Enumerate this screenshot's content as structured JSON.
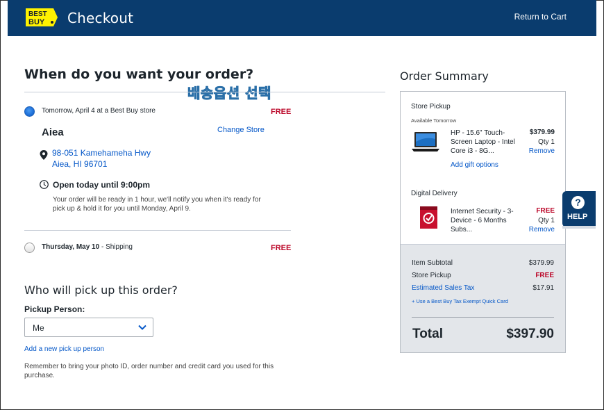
{
  "header": {
    "logo_alt": "Best Buy logo",
    "logo_text_line1": "BEST",
    "logo_text_line2": "BUY",
    "title": "Checkout",
    "return_to_cart": "Return to Cart"
  },
  "overlay_annotation": "배송옵션 선택",
  "delivery": {
    "heading": "When do you want your order?",
    "options": [
      {
        "label": "Tomorrow, April 4 at a Best Buy store",
        "price": "FREE",
        "selected": true
      },
      {
        "label_bold": "Thursday, May 10",
        "label_rest": " - Shipping",
        "price": "FREE",
        "selected": false
      }
    ],
    "store": {
      "name": "Aiea",
      "change_store": "Change Store",
      "address_line1": "98-051 Kamehameha Hwy",
      "address_line2": "Aiea, HI 96701",
      "hours": "Open today until 9:00pm",
      "ready_note": "Your order will be ready in 1 hour, we'll notify you when it's ready for pick up & hold it for you until Monday, April 9."
    }
  },
  "pickup": {
    "heading": "Who will pick up this order?",
    "person_label": "Pickup Person:",
    "person_value": "Me",
    "add_person": "Add a new pick up person",
    "remember_note": "Remember to bring your photo ID, order number and credit card you used for this purchase."
  },
  "summary": {
    "heading": "Order Summary",
    "store_pickup_title": "Store Pickup",
    "available": "Available Tomorrow",
    "laptop": {
      "name": "HP - 15.6\" Touch-Screen Laptop - Intel Core i3 - 8G...",
      "price": "$379.99",
      "qty": "Qty 1",
      "remove": "Remove",
      "gift": "Add gift options"
    },
    "digital_title": "Digital Delivery",
    "software": {
      "name": "Internet Security - 3-Device - 6 Months Subs...",
      "price": "FREE",
      "qty": "Qty 1",
      "remove": "Remove"
    },
    "rows": {
      "subtotal_label": "Item Subtotal",
      "subtotal_value": "$379.99",
      "pickup_label": "Store Pickup",
      "pickup_value": "FREE",
      "tax_label": "Estimated Sales Tax",
      "tax_value": "$17.91"
    },
    "tax_exempt": "+ Use a Best Buy Tax Exempt Quick Card",
    "total_label": "Total",
    "total_value": "$397.90"
  },
  "help": {
    "icon": "?",
    "label": "HELP"
  },
  "colors": {
    "header_bg": "#0a3c6e",
    "link": "#0457c8",
    "price_red": "#bb0628",
    "logo_yellow": "#fff200"
  }
}
